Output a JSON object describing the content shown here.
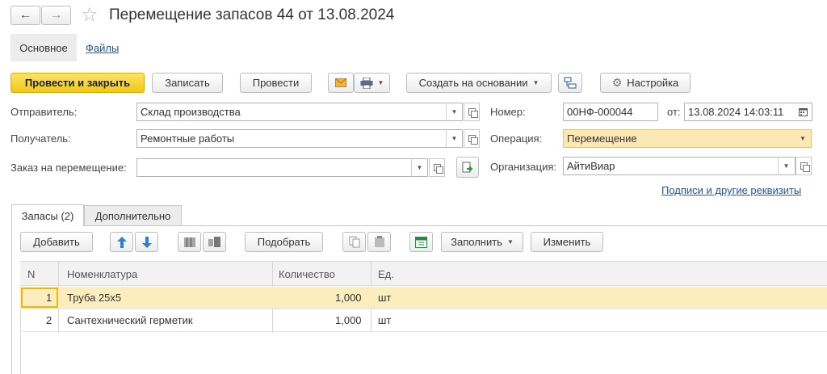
{
  "window": {
    "title": "Перемещение запасов 44 от 13.08.2024",
    "back": "←",
    "forward": "→",
    "star": "☆"
  },
  "nav": {
    "main_tab": "Основное",
    "files_link": "Файлы"
  },
  "toolbar": {
    "post_close": "Провести и закрыть",
    "save": "Записать",
    "post": "Провести",
    "create_based": "Создать на основании",
    "settings": "Настройка"
  },
  "form": {
    "sender_label": "Отправитель:",
    "sender_value": "Склад производства",
    "receiver_label": "Получатель:",
    "receiver_value": "Ремонтные работы",
    "order_label": "Заказ на перемещение:",
    "order_value": "",
    "number_label": "Номер:",
    "number_value": "00НФ-000044",
    "date_label": "от:",
    "date_value": "13.08.2024 14:03:11",
    "operation_label": "Операция:",
    "operation_value": "Перемещение",
    "org_label": "Организация:",
    "org_value": "АйтиВиар",
    "signatures_link": "Подписи и другие реквизиты"
  },
  "tabs": {
    "stocks": "Запасы (2)",
    "additional": "Дополнительно"
  },
  "table_toolbar": {
    "add": "Добавить",
    "pick": "Подобрать",
    "fill": "Заполнить",
    "edit": "Изменить"
  },
  "table": {
    "headers": [
      "N",
      "Номенклатура",
      "Количество",
      "Ед."
    ],
    "rows": [
      {
        "n": "1",
        "item": "Труба 25х5",
        "qty": "1,000",
        "unit": "шт"
      },
      {
        "n": "2",
        "item": "Сантехнический герметик",
        "qty": "1,000",
        "unit": "шт"
      }
    ]
  },
  "colors": {
    "primary_button": "#f2c814",
    "selected_row": "#fbeebc",
    "link": "#1a56a6"
  },
  "icons": [
    "back-arrow-icon",
    "forward-arrow-icon",
    "favorite-star-icon",
    "envelope-icon",
    "printer-icon",
    "report-structure-icon",
    "gear-icon",
    "calendar-icon",
    "document-link-icon",
    "move-up-icon",
    "move-down-icon",
    "barcode-icon",
    "barcode-device-icon",
    "copy-icon",
    "paste-icon",
    "excel-icon"
  ]
}
